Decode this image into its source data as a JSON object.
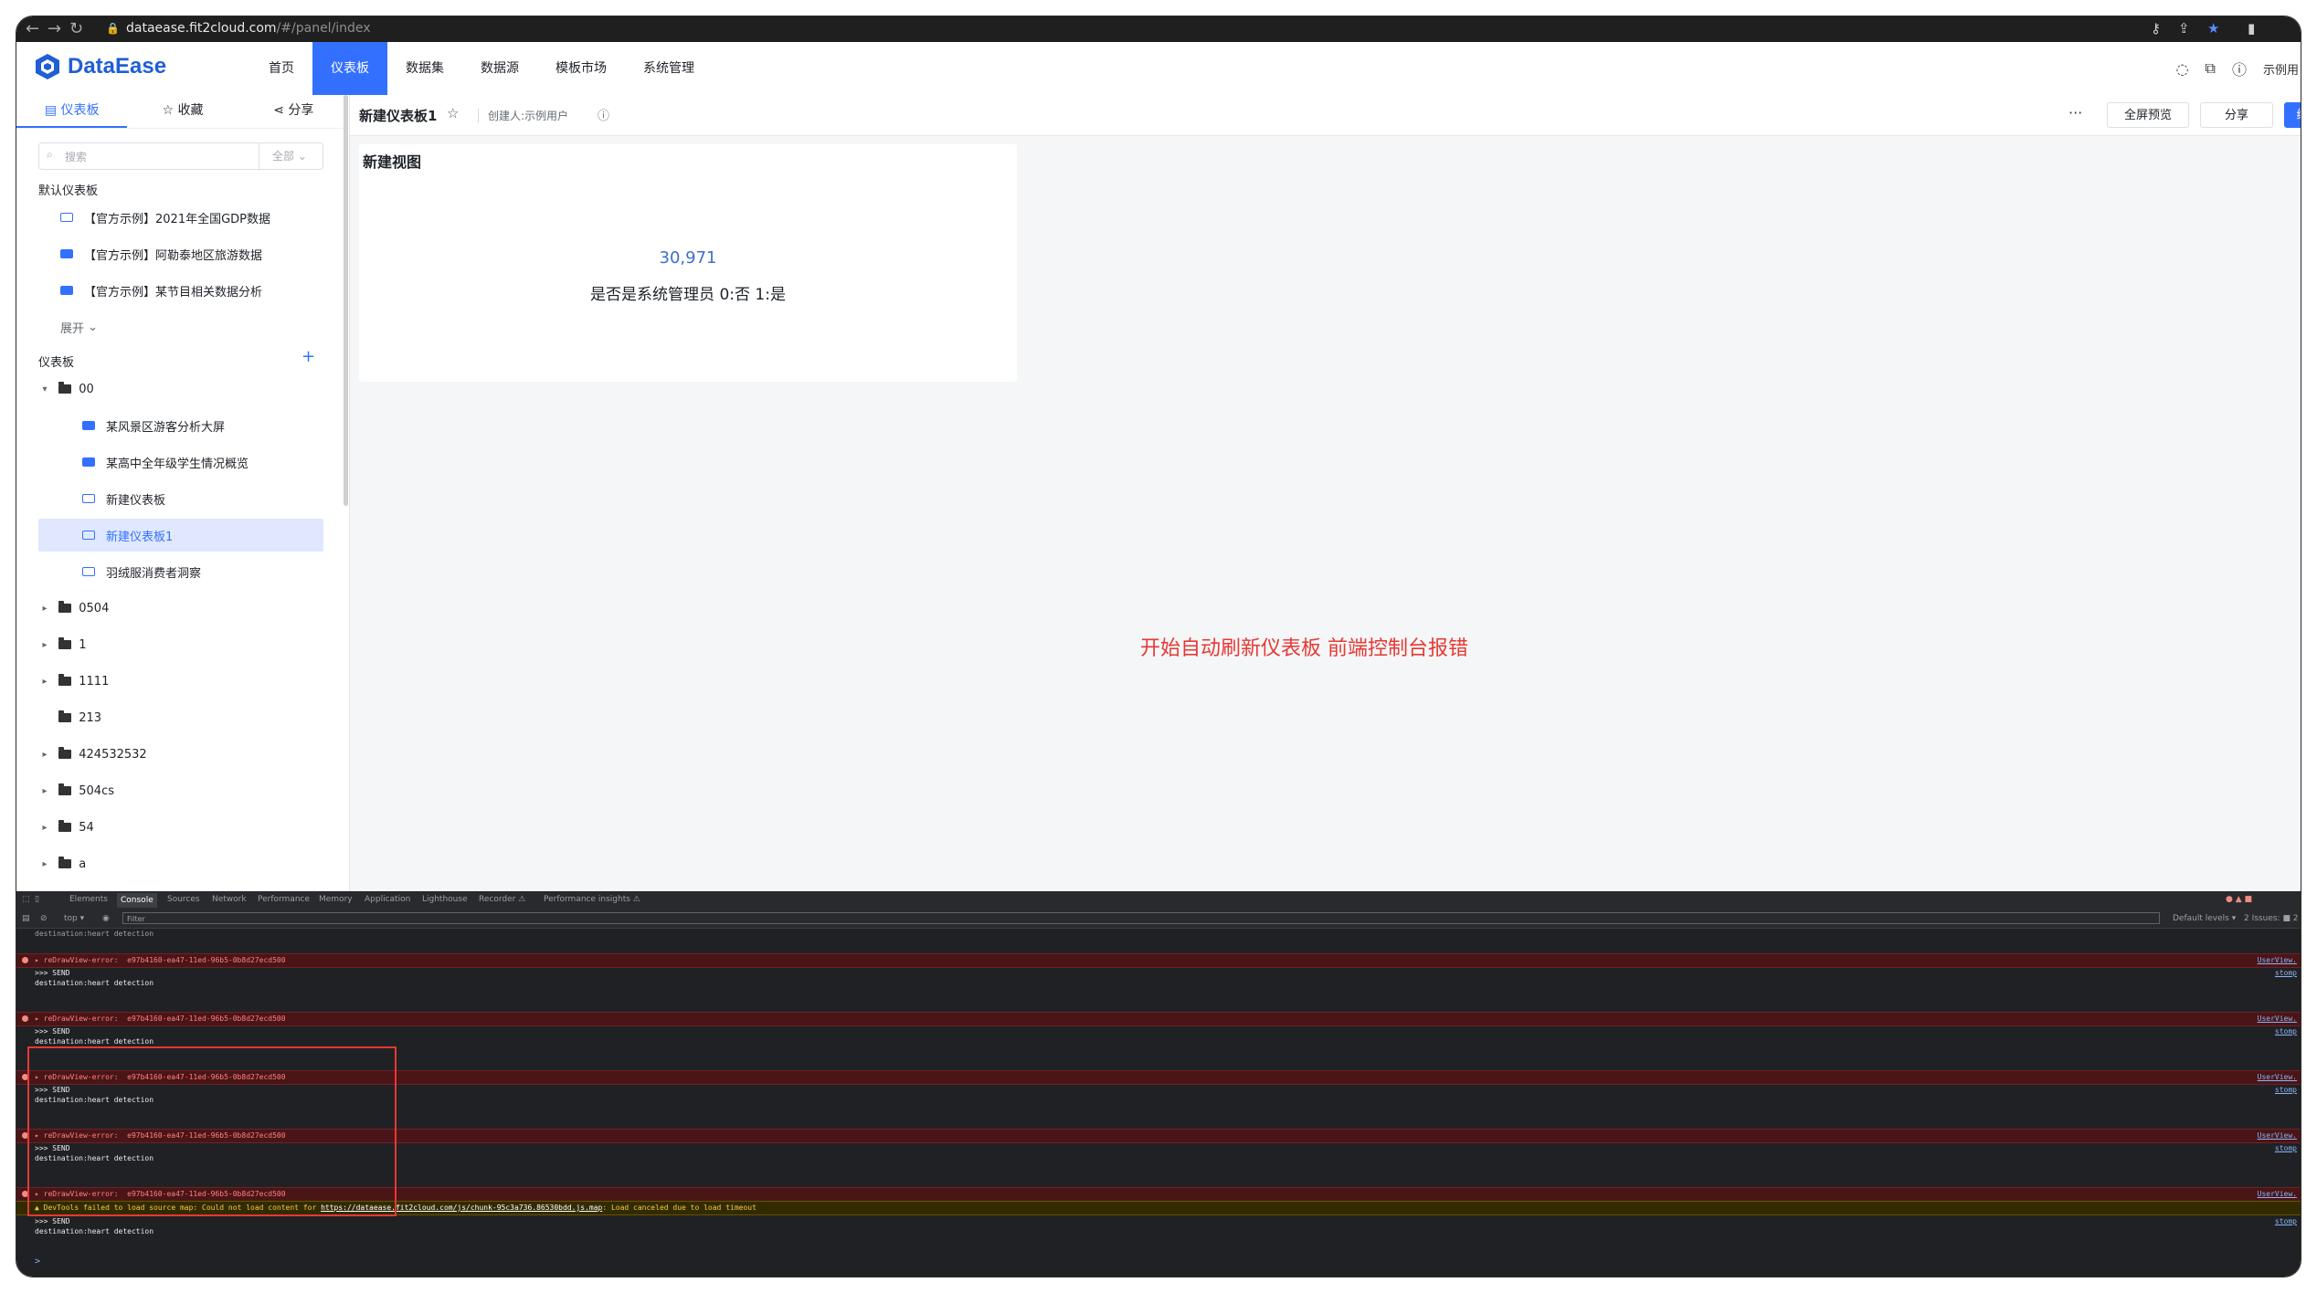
{
  "browser": {
    "url_host": "dataease.fit2cloud.com",
    "url_path": "/#/panel/index"
  },
  "app": {
    "logo_text": "DataEase",
    "nav": [
      "首页",
      "仪表板",
      "数据集",
      "数据源",
      "模板市场",
      "系统管理"
    ],
    "active_nav": "仪表板",
    "user": "示例用"
  },
  "sidebar": {
    "tabs": [
      "仪表板",
      "收藏",
      "分享"
    ],
    "search_placeholder": "搜索",
    "search_filter": "全部",
    "default_section_title": "默认仪表板",
    "default_items": [
      "【官方示例】2021年全国GDP数据",
      "【官方示例】阿勒泰地区旅游数据",
      "【官方示例】某节目相关数据分析"
    ],
    "expand_label": "展开",
    "panel_section_title": "仪表板",
    "tree": [
      {
        "label": "00"
      },
      {
        "label": "某风景区游客分析大屏"
      },
      {
        "label": "某高中全年级学生情况概览"
      },
      {
        "label": "新建仪表板"
      },
      {
        "label": "新建仪表板1"
      },
      {
        "label": "羽绒服消费者洞察"
      },
      {
        "label": "0504"
      },
      {
        "label": "1"
      },
      {
        "label": "1111"
      },
      {
        "label": "213"
      },
      {
        "label": "424532532"
      },
      {
        "label": "504cs"
      },
      {
        "label": "54"
      },
      {
        "label": "a"
      }
    ]
  },
  "main": {
    "title": "新建仪表板1",
    "creator": "创建人:示例用户",
    "buttons": {
      "fullscreen": "全屏预览",
      "share": "分享",
      "edit": "编"
    },
    "card": {
      "title": "新建视图",
      "value": "30,971",
      "label": "是否是系统管理员 0:否 1:是"
    },
    "annotation": "开始自动刷新仪表板 前端控制台报错"
  },
  "devtools": {
    "tabs": [
      "Elements",
      "Console",
      "Sources",
      "Network",
      "Performance",
      "Memory",
      "Application",
      "Lighthouse",
      "Recorder ⚠",
      "Performance insights ⚠"
    ],
    "active_tab": "Console",
    "context": "top ▾",
    "filter_placeholder": "Filter",
    "levels": "Default levels ▾",
    "issues": "2 Issues: ■ 2",
    "error_text": "▸ reDrawView-error:  e97b4160-ea47-11ed-96b5-0b8d27ecd500",
    "send_text": ">>> SEND",
    "dest_text": "destination:heart detection",
    "src_user": "UserView.",
    "src_stomp": "stomp",
    "warning_prefix": "DevTools failed to load source map: Could not load content for ",
    "warning_link": "https://dataease.fit2cloud.com/js/chunk-95c3a736.86530bdd.js.map",
    "warning_suffix": ": Load canceled due to load timeout",
    "prompt": ">"
  },
  "colors": {
    "primary": "#3370ff",
    "annotation_red": "#e53935",
    "console_error_bg": "#4a1517"
  }
}
